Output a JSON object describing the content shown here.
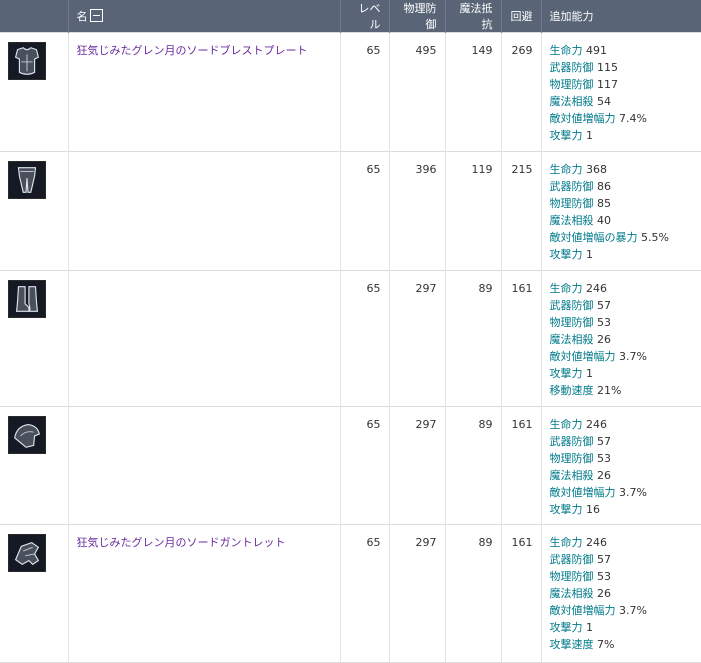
{
  "header": {
    "name_label": "名",
    "level_label": "レベル",
    "phys_def_label": "物理防御",
    "mag_res_label": "魔法抵抗",
    "evade_label": "回避",
    "bonus_label": "追加能力"
  },
  "rows": [
    {
      "icon": "chest-armor-icon",
      "name": "狂気じみたグレン月のソードブレストプレート",
      "level": "65",
      "phys_def": "495",
      "mag_res": "149",
      "evade": "269",
      "stats": [
        {
          "label": "生命力",
          "value": "491"
        },
        {
          "label": "武器防御",
          "value": "115"
        },
        {
          "label": "物理防御",
          "value": "117"
        },
        {
          "label": "魔法相殺",
          "value": "54"
        },
        {
          "label": "敵対値増幅力",
          "value": "7.4%"
        },
        {
          "label": "攻撃力",
          "value": "1"
        }
      ]
    },
    {
      "icon": "leg-armor-icon",
      "name": "",
      "level": "65",
      "phys_def": "396",
      "mag_res": "119",
      "evade": "215",
      "stats": [
        {
          "label": "生命力",
          "value": "368"
        },
        {
          "label": "武器防御",
          "value": "86"
        },
        {
          "label": "物理防御",
          "value": "85"
        },
        {
          "label": "魔法相殺",
          "value": "40"
        },
        {
          "label": "敵対値増幅の暴力",
          "value": "5.5%"
        },
        {
          "label": "攻撃力",
          "value": "1"
        }
      ]
    },
    {
      "icon": "boots-icon",
      "name": "",
      "level": "65",
      "phys_def": "297",
      "mag_res": "89",
      "evade": "161",
      "stats": [
        {
          "label": "生命力",
          "value": "246"
        },
        {
          "label": "武器防御",
          "value": "57"
        },
        {
          "label": "物理防御",
          "value": "53"
        },
        {
          "label": "魔法相殺",
          "value": "26"
        },
        {
          "label": "敵対値増幅力",
          "value": "3.7%"
        },
        {
          "label": "攻撃力",
          "value": "1"
        },
        {
          "label": "移動速度",
          "value": "21%"
        }
      ]
    },
    {
      "icon": "shoulder-armor-icon",
      "name": "",
      "level": "65",
      "phys_def": "297",
      "mag_res": "89",
      "evade": "161",
      "stats": [
        {
          "label": "生命力",
          "value": "246"
        },
        {
          "label": "武器防御",
          "value": "57"
        },
        {
          "label": "物理防御",
          "value": "53"
        },
        {
          "label": "魔法相殺",
          "value": "26"
        },
        {
          "label": "敵対値増幅力",
          "value": "3.7%"
        },
        {
          "label": "攻撃力",
          "value": "16"
        }
      ]
    },
    {
      "icon": "gauntlet-icon",
      "name": "狂気じみたグレン月のソードガントレット",
      "level": "65",
      "phys_def": "297",
      "mag_res": "89",
      "evade": "161",
      "stats": [
        {
          "label": "生命力",
          "value": "246"
        },
        {
          "label": "武器防御",
          "value": "57"
        },
        {
          "label": "物理防御",
          "value": "53"
        },
        {
          "label": "魔法相殺",
          "value": "26"
        },
        {
          "label": "敵対値増幅力",
          "value": "3.7%"
        },
        {
          "label": "攻撃力",
          "value": "1"
        },
        {
          "label": "攻撃速度",
          "value": "7%"
        }
      ]
    }
  ]
}
